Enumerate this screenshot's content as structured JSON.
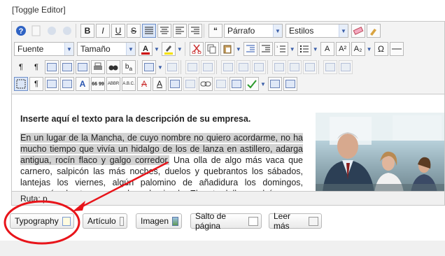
{
  "toggle_editor": "[Toggle Editor]",
  "toolbar": {
    "format_select": "Párrafo",
    "styles_select": "Estilos",
    "font_select": "Fuente",
    "size_select": "Tamaño",
    "bold": "B",
    "italic": "I",
    "underline": "U",
    "strike": "S",
    "quote": "“",
    "superscript": "A²",
    "subscript": "A₂",
    "omega": "Ω",
    "pilcrow": "¶",
    "pilcrow_rtl": "¶",
    "font_a": "A",
    "quote_text": "66 99",
    "abbr": "ABBR",
    "acronym": "A.B.C.",
    "del_a": "A",
    "ins_a": "A"
  },
  "editor": {
    "heading": "Inserte aquí el texto para la descripción de su empresa.",
    "para_highlight": "En un lugar de la Mancha, de cuyo nombre no quiero acordarme, no ha mucho tiempo que vivía un hidalgo de los de lanza en astillero, adarga antigua, rocín flaco y galgo corredor.",
    "para_rest": " Una olla de algo más vaca que carnero, salpicón las más noches, duelos y quebrantos los sábados, lantejas los viernes, algún palomino de añadidura los domingos, consumían las tres partes de su hacienda. El resto della concluían sayo de"
  },
  "path_bar": "Ruta: p",
  "buttons": {
    "typography": "Typography",
    "articulo": "Artículo",
    "imagen": "Imagen",
    "salto": "Salto de página",
    "leer_mas": "Leer más"
  },
  "colors": {
    "highlight": "#d3d3d3",
    "annotation_red": "#e8141a",
    "toolbar_bg": "#f3f3f3",
    "active_button": "#dbe6f7"
  }
}
